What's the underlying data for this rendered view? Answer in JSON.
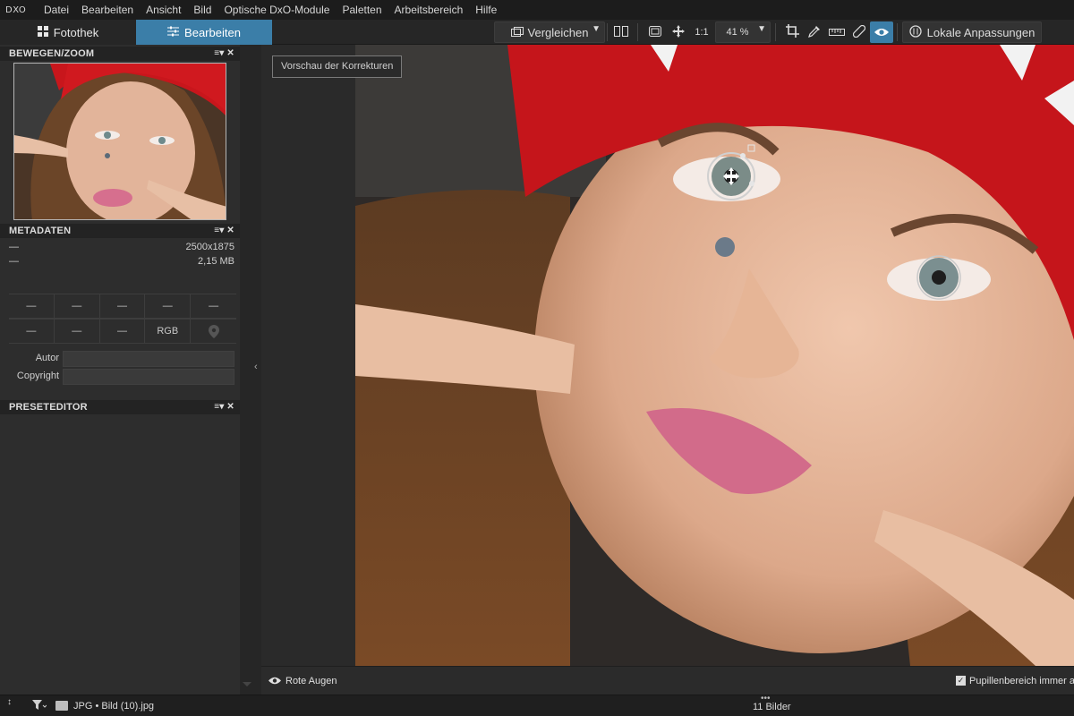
{
  "menu": {
    "logo": "DXO",
    "items": [
      "Datei",
      "Bearbeiten",
      "Ansicht",
      "Bild",
      "Optische DxO-Module",
      "Paletten",
      "Arbeitsbereich",
      "Hilfe"
    ]
  },
  "tabs": {
    "fotothek": "Fotothek",
    "bearbeiten": "Bearbeiten"
  },
  "toolbar": {
    "compare_label": "Vergleichen",
    "oneone_label": "1:1",
    "zoom_value": "41 %",
    "local_label": "Lokale Anpassungen",
    "accent_color": "#3b7ea8"
  },
  "panels": {
    "move_zoom": "BEWEGEN/ZOOM",
    "metadata": "METADATEN",
    "preset_editor": "PRESETEDITOR",
    "controls": "≡▾ ✕"
  },
  "metadata": {
    "rows": [
      {
        "key": "—",
        "value": "2500x1875"
      },
      {
        "key": "—",
        "value": "2,15 MB"
      }
    ],
    "exif": [
      "—",
      "—",
      "—",
      "—",
      "—",
      "—",
      "—",
      "—",
      "RGB",
      ""
    ],
    "author_label": "Autor",
    "copyright_label": "Copyright"
  },
  "viewer": {
    "preview_tooltip": "Vorschau der Korrekturen"
  },
  "bottom_tool": {
    "tool_name": "Rote Augen",
    "pupil_option": "Pupillenbereich immer an",
    "pupil_checked": true
  },
  "status": {
    "path": "JPG • Bild (10).jpg",
    "image_count": "11 Bilder"
  }
}
